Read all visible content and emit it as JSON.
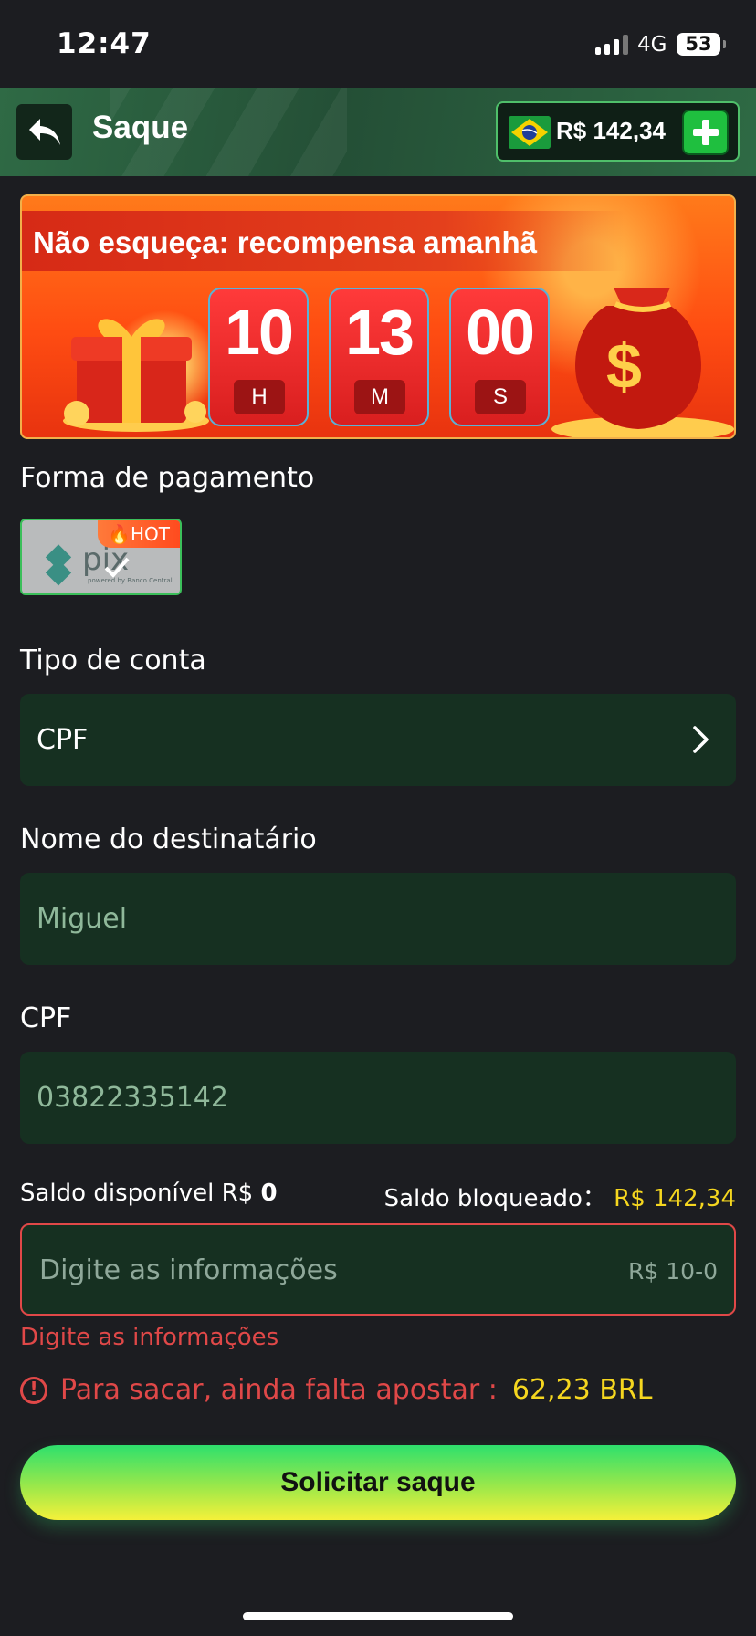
{
  "status": {
    "time": "12:47",
    "network": "4G",
    "battery": "53"
  },
  "header": {
    "title": "Saque",
    "balance": "R$ 142,34"
  },
  "banner": {
    "text": "Não esqueça: recompensa amanhã",
    "timer": [
      {
        "value": "10",
        "unit": "H"
      },
      {
        "value": "13",
        "unit": "M"
      },
      {
        "value": "00",
        "unit": "S"
      }
    ]
  },
  "payment": {
    "label": "Forma de pagamento",
    "method": "pix",
    "badge": "HOT"
  },
  "account_type": {
    "label": "Tipo de conta",
    "value": "CPF"
  },
  "recipient": {
    "label": "Nome do destinatário",
    "value": "Miguel"
  },
  "cpf": {
    "label": "CPF",
    "value": "03822335142"
  },
  "saldo": {
    "available_label": "Saldo disponível R$",
    "available_value": "0",
    "blocked_label": "Saldo bloqueado：",
    "blocked_value": "R$ 142,34"
  },
  "amount": {
    "placeholder": "Digite as informações",
    "range": "R$ 10-0",
    "error": "Digite as informações"
  },
  "warning": {
    "text": "Para sacar, ainda falta apostar :",
    "value": "62,23 BRL"
  },
  "submit": {
    "label": "Solicitar saque"
  },
  "colors": {
    "accent_green": "#1fbf3f",
    "field_bg": "#163021",
    "error": "#e04848",
    "highlight": "#f5d61f"
  }
}
